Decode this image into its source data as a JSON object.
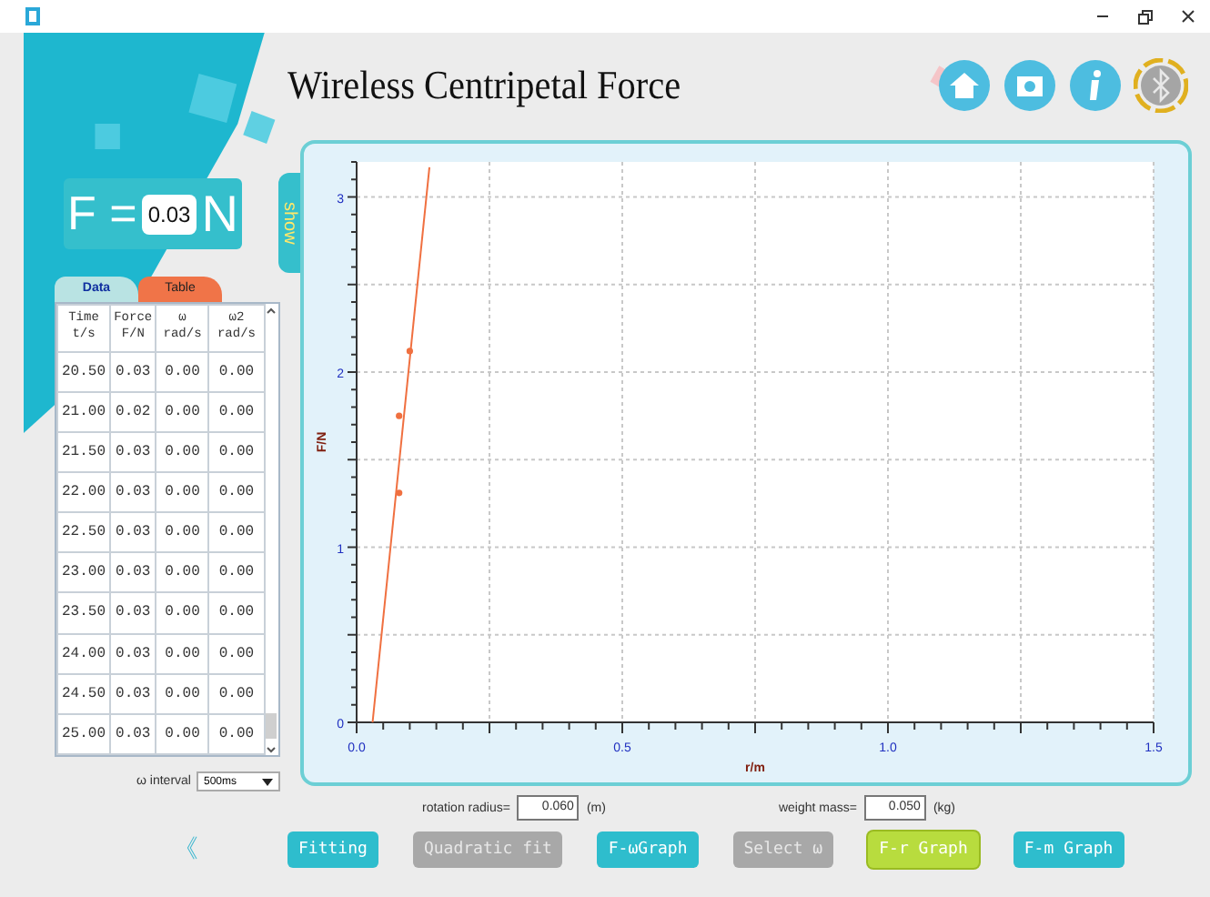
{
  "window": {
    "title": "Wireless Centripetal Force"
  },
  "force": {
    "label_left": "F =",
    "value": "0.03",
    "unit": "N"
  },
  "show_tab": "show",
  "tabs": [
    {
      "label": "Data",
      "selected": true
    },
    {
      "label": "Table",
      "selected": false
    }
  ],
  "table": {
    "columns": [
      {
        "name": "Time",
        "unit": "t/s"
      },
      {
        "name": "Force",
        "unit": "F/N"
      },
      {
        "name": "ω",
        "unit": "rad/s"
      },
      {
        "name": "ω2",
        "unit": "rad/s"
      }
    ],
    "rows": [
      [
        "20.50",
        "0.03",
        "0.00",
        "0.00"
      ],
      [
        "21.00",
        "0.02",
        "0.00",
        "0.00"
      ],
      [
        "21.50",
        "0.03",
        "0.00",
        "0.00"
      ],
      [
        "22.00",
        "0.03",
        "0.00",
        "0.00"
      ],
      [
        "22.50",
        "0.03",
        "0.00",
        "0.00"
      ],
      [
        "23.00",
        "0.03",
        "0.00",
        "0.00"
      ],
      [
        "23.50",
        "0.03",
        "0.00",
        "0.00"
      ],
      [
        "24.00",
        "0.03",
        "0.00",
        "0.00"
      ],
      [
        "24.50",
        "0.03",
        "0.00",
        "0.00"
      ],
      [
        "25.00",
        "0.03",
        "0.00",
        "0.00"
      ]
    ]
  },
  "interval": {
    "label": "ω interval",
    "value": "500ms"
  },
  "chart": {
    "chart_data": {
      "type": "scatter",
      "grid": true,
      "xlabel": "r/m",
      "ylabel": "F/N",
      "xlim": [
        0,
        1.5
      ],
      "ylim": [
        0,
        3.2
      ],
      "xticks": [
        {
          "value": 0,
          "label": "0.0"
        },
        {
          "value": 0.5,
          "label": "0.5"
        },
        {
          "value": 1,
          "label": "1.0"
        },
        {
          "value": 1.5,
          "label": "1.5"
        }
      ],
      "yticks": [
        0,
        1,
        2,
        3
      ],
      "series": [
        {
          "color": "#f07040",
          "x": [
            0.08,
            0.08,
            0.1
          ],
          "values": [
            1.31,
            1.75,
            2.12
          ]
        },
        {
          "type": "line",
          "color": "#f07040",
          "x": [
            0.03,
            0.137
          ],
          "values": [
            0,
            3.17
          ]
        }
      ]
    }
  },
  "params": [
    {
      "label": "rotation radius=",
      "value": "0.060",
      "unit": "(m)"
    },
    {
      "label": "weight mass=",
      "value": "0.050",
      "unit": "(kg)"
    }
  ],
  "back": "《",
  "buttons": [
    {
      "label": "Fitting",
      "selected": false,
      "disabled": false
    },
    {
      "label": "Quadratic fit",
      "selected": false,
      "disabled": true
    },
    {
      "label": "F-ωGraph",
      "selected": false,
      "disabled": false
    },
    {
      "label": "Select ω",
      "selected": false,
      "disabled": true
    },
    {
      "label": "F-r Graph",
      "selected": true,
      "disabled": false
    },
    {
      "label": "F-m Graph",
      "selected": false,
      "disabled": false
    }
  ]
}
